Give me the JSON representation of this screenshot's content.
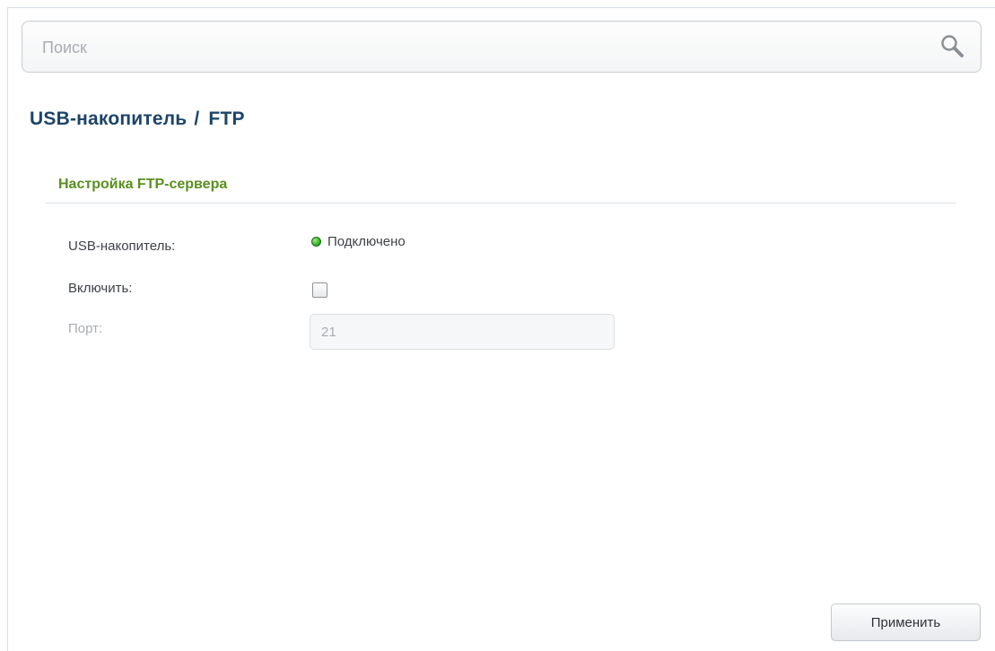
{
  "search": {
    "placeholder": "Поиск",
    "value": ""
  },
  "page": {
    "breadcrumb_parent": "USB-накопитель",
    "breadcrumb_separator": "/",
    "breadcrumb_current": "FTP"
  },
  "section": {
    "title": "Настройка FTP-сервера"
  },
  "fields": {
    "usb_label": "USB-накопитель:",
    "usb_status": "Подключено",
    "usb_status_color": "#29a31d",
    "enable_label": "Включить:",
    "enable_checked": false,
    "port_label": "Порт:",
    "port_value": "21",
    "port_disabled": true
  },
  "actions": {
    "apply_label": "Применить"
  },
  "colors": {
    "title": "#1d4469",
    "section_title": "#5a8f1f"
  }
}
